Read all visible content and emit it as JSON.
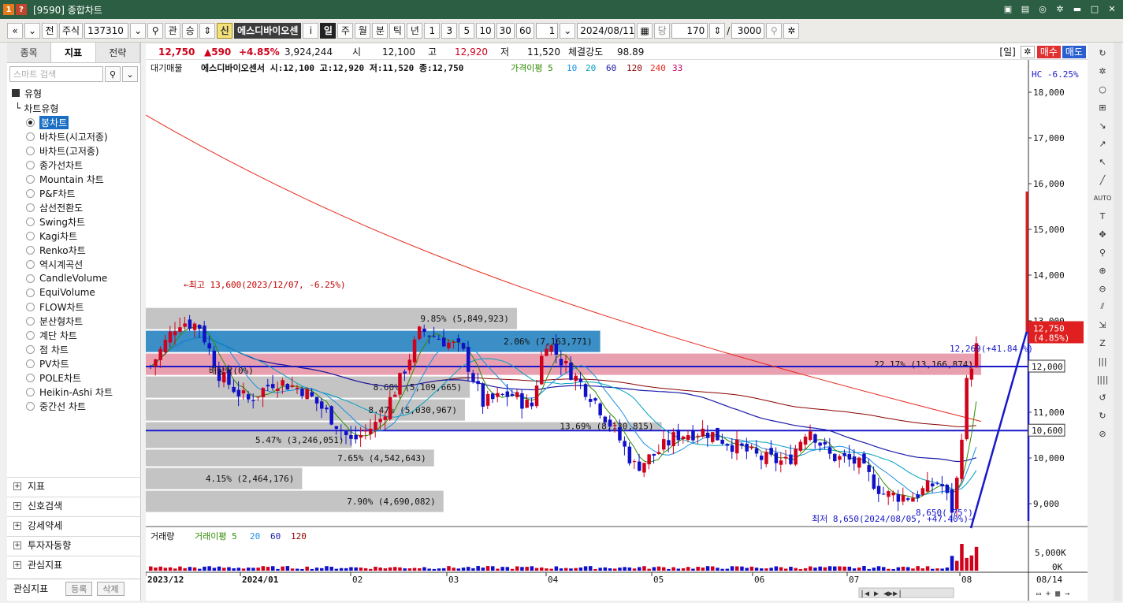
{
  "window": {
    "badge1": "1",
    "badge2": "?",
    "title": "[9590] 종합차트"
  },
  "toolbar": {
    "nav_prev": "«",
    "nav_down": "⌄",
    "prev": "전",
    "market": "주식",
    "code": "137310",
    "rel": "관",
    "up": "승",
    "sin": "신",
    "stock_name": "에스디바이오센",
    "info": "i",
    "periods": [
      "일",
      "주",
      "월",
      "분",
      "틱",
      "년"
    ],
    "minutes": [
      "1",
      "3",
      "5",
      "10",
      "30",
      "60"
    ],
    "unit": "1",
    "date": "2024/08/11",
    "dang": "당",
    "count": "170",
    "slash": "/",
    "total": "3000"
  },
  "left": {
    "tabs": [
      "종목",
      "지표",
      "전략"
    ],
    "search_placeholder": "스마트 검색",
    "group": "유형",
    "subgroup": "차트유형",
    "chart_types": [
      "봉차트",
      "바차트(시고저종)",
      "바차트(고저종)",
      "종가선차트",
      "Mountain 차트",
      "P&F차트",
      "삼선전환도",
      "Swing차트",
      "Kagi차트",
      "Renko차트",
      "역시계곡선",
      "CandleVolume",
      "EquiVolume",
      "FLOW차트",
      "분산형차트",
      "계단 차트",
      "점 차트",
      "PV차트",
      "POLE차트",
      "Heikin-Ashi 차트",
      "중간선 차트"
    ],
    "sections": [
      "지표",
      "신호검색",
      "강세약세",
      "투자자동향",
      "관심지표"
    ],
    "bottom_label": "관심지표",
    "btn_register": "등록",
    "btn_delete": "삭제"
  },
  "quote": {
    "price": "12,750",
    "change": "▲590",
    "change_pct": "+4.85%",
    "volume": "3,924,244",
    "open_label": "시",
    "open": "12,100",
    "high_label": "고",
    "high": "12,920",
    "low_label": "저",
    "low": "11,520",
    "strength_label": "체결강도",
    "strength": "98.89",
    "period_tag": "[일]",
    "buy": "매수",
    "sell": "매도"
  },
  "colors": {
    "up": "#d0021b",
    "down": "#1010c8",
    "ma5": "#2e8b00",
    "ma10": "#1a8fe0",
    "ma20": "#00a0c0",
    "ma60": "#1a1aa8",
    "ma120": "#8b0000",
    "ma240": "#e8281c"
  },
  "chart_data": {
    "type": "candlestick",
    "legend": {
      "title": "대기매물",
      "stock": "에스디바이오센서 시:12,100 고:12,920 저:11,520 종:12,750",
      "ma_label": "가격이평 5",
      "ma_periods": [
        "10",
        "20",
        "60",
        "120",
        "240",
        "33"
      ]
    },
    "hc_label": "HC -6.25%",
    "y_ticks": [
      "18,000",
      "17,000",
      "16,000",
      "15,000",
      "14,000",
      "13,000",
      "12,000",
      "11,000",
      "10,000",
      "9,000"
    ],
    "ylim": [
      8500,
      18500
    ],
    "x_ticks": [
      "2023/12",
      "2024/01",
      "02",
      "03",
      "04",
      "05",
      "06",
      "07",
      "08"
    ],
    "x_right": "08/14",
    "price_tag": "12,750",
    "price_tag_pct": "(4.85%)",
    "hline_1": "12,000",
    "hline_2": "10,600",
    "annotations": {
      "high": "←최고 13,600(2023/12/07, -6.25%)",
      "low": "최저 8,650(2024/08/05, +47.40%)→",
      "dividend": "배당락(0%)",
      "line_label": "12,269(+41.84 %)",
      "angle": "8,650( 75°)"
    },
    "volume_profile": [
      {
        "label": "9.85% (5,849,923)",
        "from": 12800,
        "to": 13300,
        "pct": 9.85
      },
      {
        "label": "2.06% (7,163,771)",
        "from": 12300,
        "to": 12800,
        "pct": 12.06
      },
      {
        "label": "22.17% (13,166,874)",
        "from": 11800,
        "to": 12300,
        "pct": 22.17
      },
      {
        "label": "8.60% (5,109,665)",
        "from": 11300,
        "to": 11800,
        "pct": 8.6
      },
      {
        "label": "8.47% (5,030,967)",
        "from": 10800,
        "to": 11300,
        "pct": 8.47
      },
      {
        "label": "13.69% (8,130,815)",
        "from": 10600,
        "to": 10800,
        "pct": 13.69
      },
      {
        "label": "5.47% (3,246,051)",
        "from": 10200,
        "to": 10600,
        "pct": 5.47
      },
      {
        "label": "7.65% (4,542,643)",
        "from": 9800,
        "to": 10200,
        "pct": 7.65
      },
      {
        "label": "4.15% (2,464,176)",
        "from": 9300,
        "to": 9800,
        "pct": 4.15
      },
      {
        "label": "7.90% (4,690,082)",
        "from": 8800,
        "to": 9300,
        "pct": 7.9
      }
    ],
    "volume_legend": {
      "title": "거래량",
      "ma_label": "거래이평 5",
      "periods": [
        "20",
        "60",
        "120"
      ]
    },
    "volume_ticks": [
      "5,000K",
      "0K"
    ]
  }
}
